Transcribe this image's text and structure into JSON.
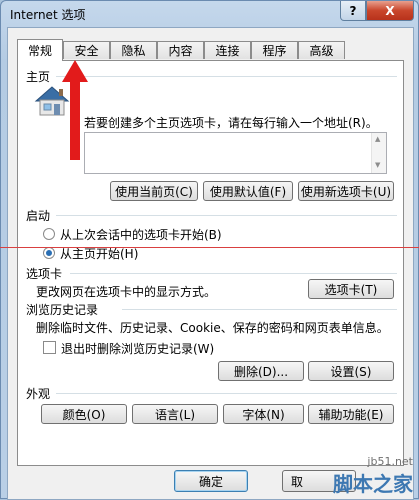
{
  "window": {
    "title": "Internet 选项",
    "help_label": "?",
    "close_label": "X"
  },
  "tabs": [
    {
      "label": "常规",
      "active": true
    },
    {
      "label": "安全"
    },
    {
      "label": "隐私"
    },
    {
      "label": "内容"
    },
    {
      "label": "连接"
    },
    {
      "label": "程序"
    },
    {
      "label": "高级"
    }
  ],
  "homepage": {
    "group_label": "主页",
    "description": "若要创建多个主页选项卡，请在每行输入一个地址(R)。",
    "url_value": "",
    "buttons": {
      "use_current": "使用当前页(C)",
      "use_default": "使用默认值(F)",
      "use_new_tab": "使用新选项卡(U)"
    }
  },
  "startup": {
    "group_label": "启动",
    "option_last_session": "从上次会话中的选项卡开始(B)",
    "option_homepage": "从主页开始(H)",
    "selected": "option_homepage"
  },
  "tabs_section": {
    "group_label": "选项卡",
    "description": "更改网页在选项卡中的显示方式。",
    "button": "选项卡(T)"
  },
  "history": {
    "group_label": "浏览历史记录",
    "description": "删除临时文件、历史记录、Cookie、保存的密码和网页表单信息。",
    "checkbox_label": "退出时删除浏览历史记录(W)",
    "checked": false,
    "delete_button": "删除(D)...",
    "settings_button": "设置(S)"
  },
  "appearance": {
    "group_label": "外观",
    "colors": "颜色(O)",
    "languages": "语言(L)",
    "fonts": "字体(N)",
    "accessibility": "辅助功能(E)"
  },
  "footer": {
    "ok": "确定",
    "partial_button": "取"
  },
  "watermark": {
    "url": "jb51.net",
    "name": "脚本之家"
  },
  "colors": {
    "annotation_red": "#d94040",
    "accent_blue": "#3c7fb1"
  }
}
